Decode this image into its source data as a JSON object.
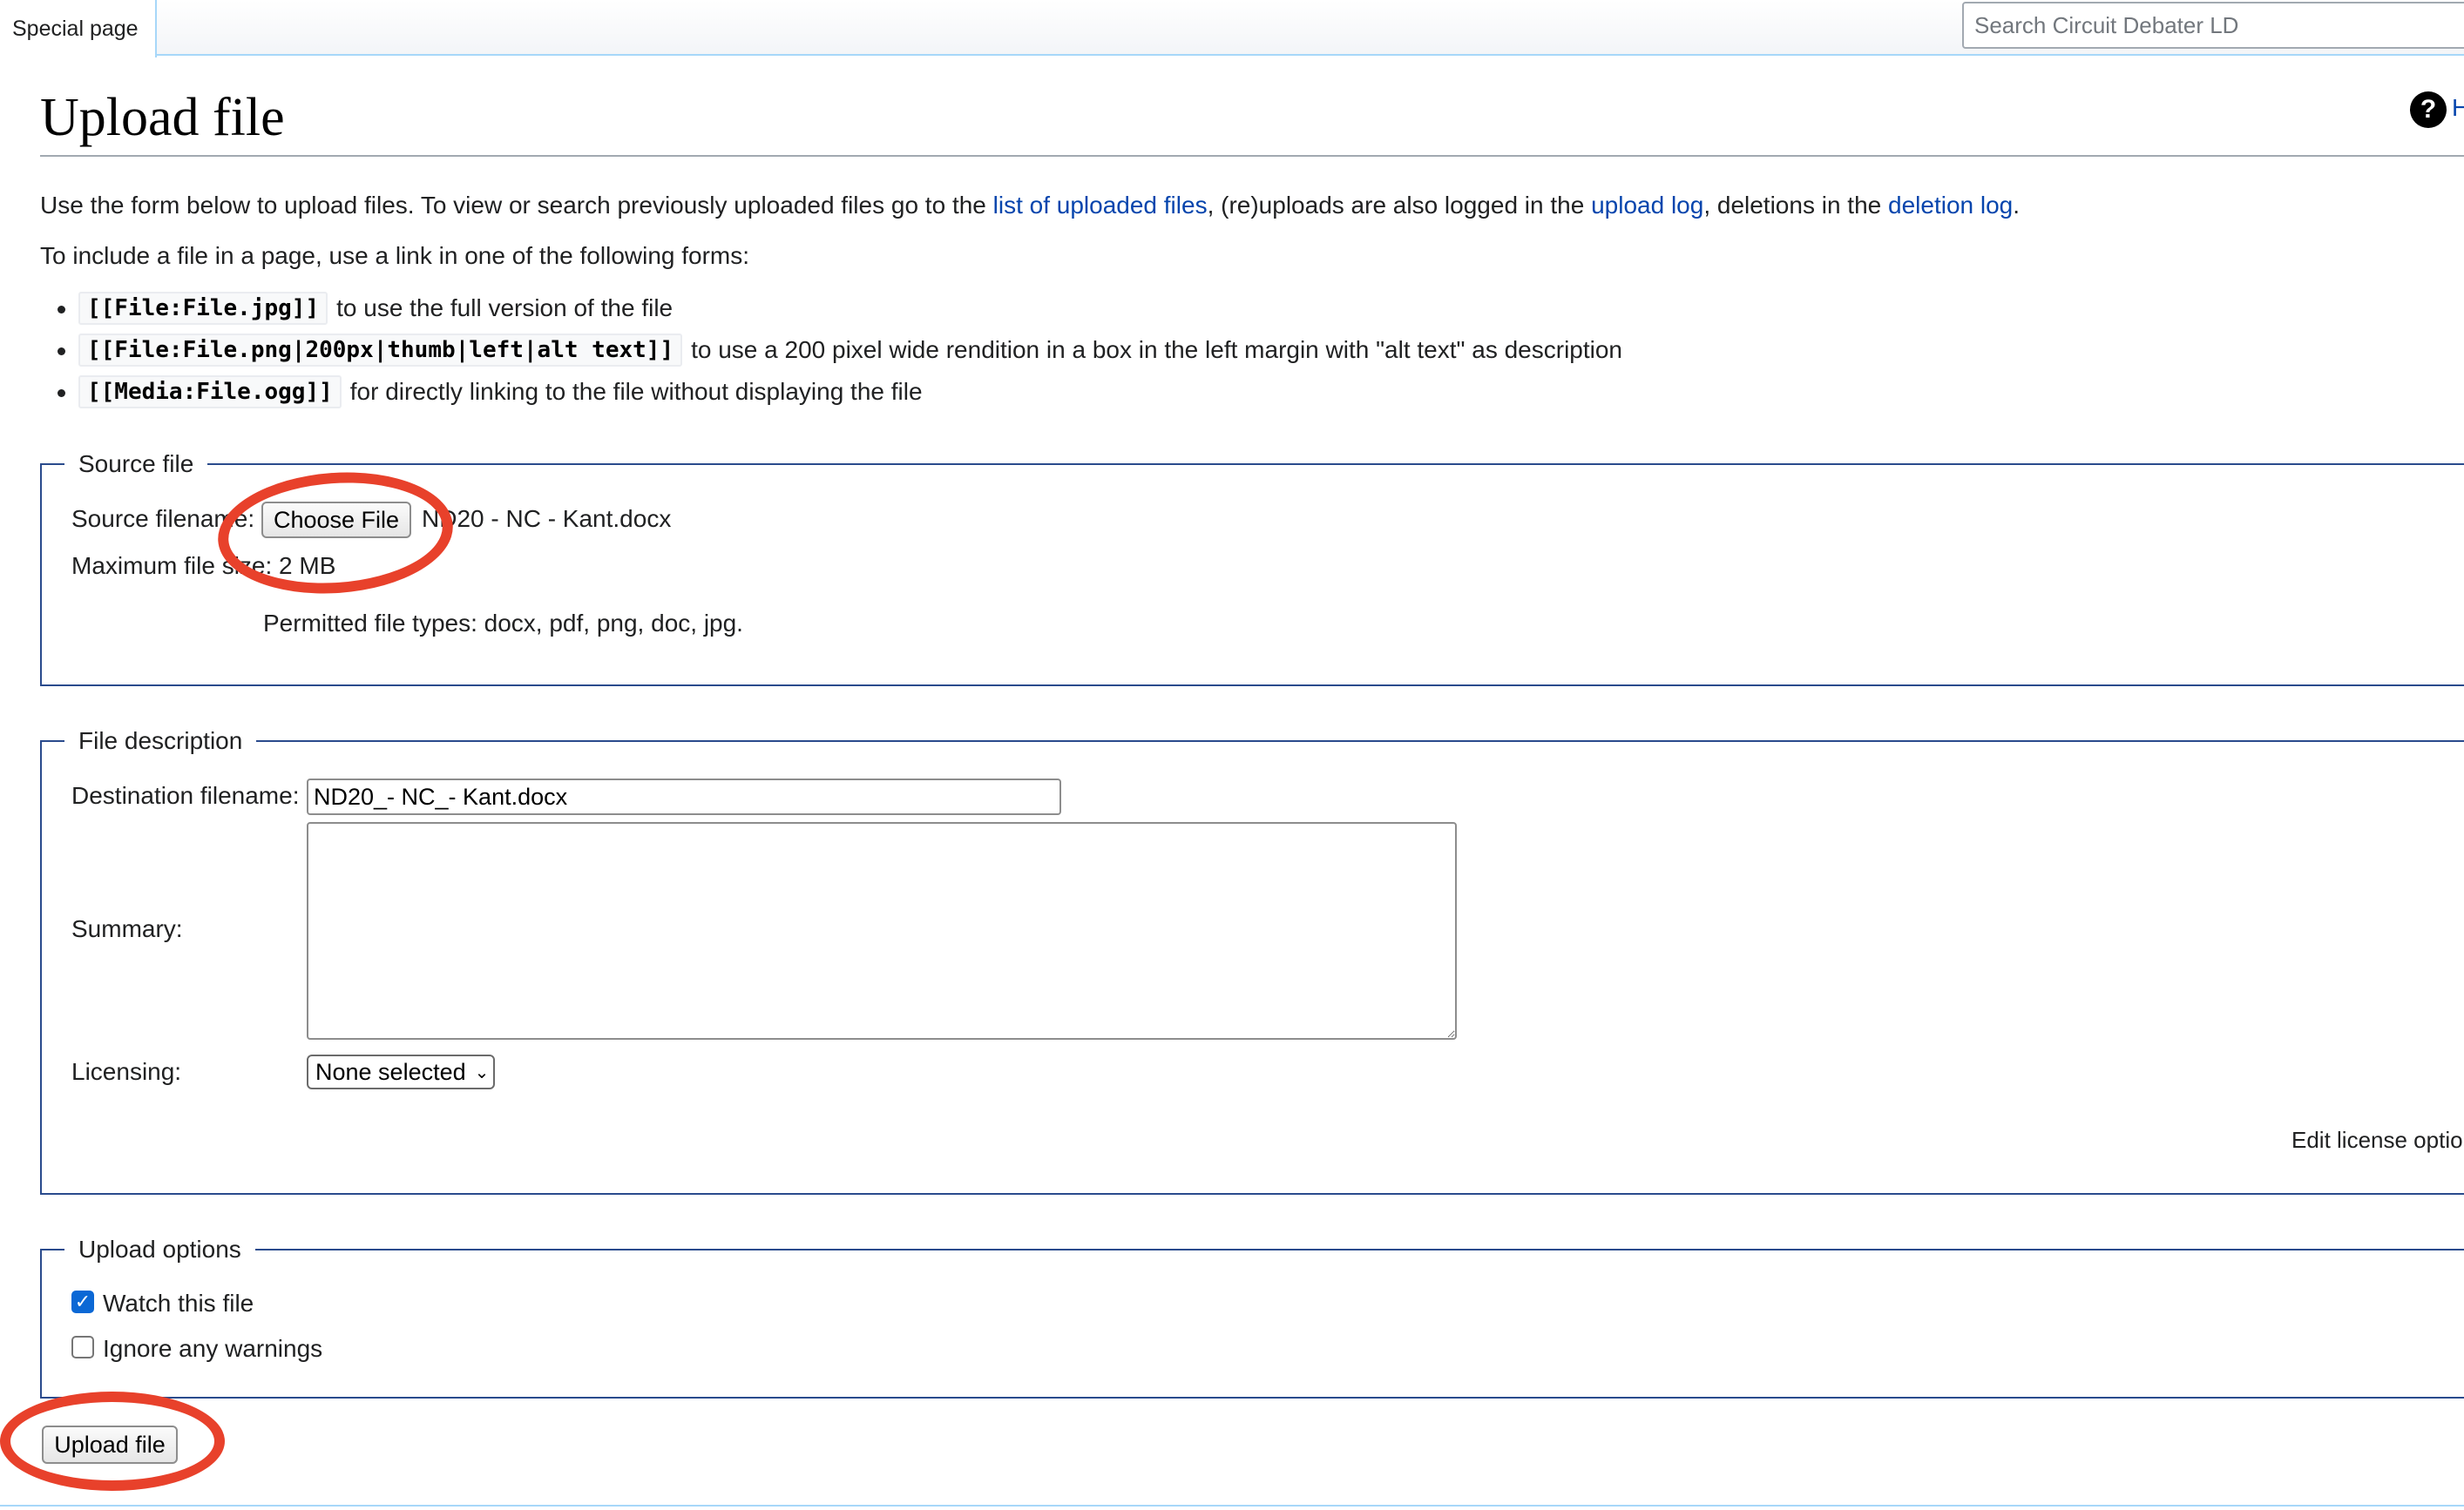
{
  "header": {
    "namespace_tab": "Special page",
    "search_placeholder": "Search Circuit Debater LD"
  },
  "page": {
    "title": "Upload file",
    "help_label": "H"
  },
  "intro": {
    "line1_before": "Use the form below to upload files. To view or search previously uploaded files go to the ",
    "link_uploaded_files": "list of uploaded files",
    "line1_mid": ", (re)uploads are also logged in the ",
    "link_upload_log": "upload log",
    "line1_mid2": ", deletions in the ",
    "link_deletion_log": "deletion log",
    "line1_end": ".",
    "line2": "To include a file in a page, use a link in one of the following forms:",
    "forms": [
      {
        "code": "[[File:File.jpg]]",
        "text": "to use the full version of the file"
      },
      {
        "code": "[[File:File.png|200px|thumb|left|alt text]]",
        "text": "to use a 200 pixel wide rendition in a box in the left margin with \"alt text\" as description"
      },
      {
        "code": "[[Media:File.ogg]]",
        "text": "for directly linking to the file without displaying the file"
      }
    ]
  },
  "source_file": {
    "legend": "Source file",
    "filename_label": "Source filename:",
    "choose_button": "Choose File",
    "chosen_file": "ND20 - NC - Kant.docx",
    "max_size": "Maximum file size: 2 MB",
    "permitted_types": "Permitted file types: docx, pdf, png, doc, jpg."
  },
  "file_description": {
    "legend": "File description",
    "destination_label": "Destination filename:",
    "destination_value": "ND20_- NC_- Kant.docx",
    "summary_label": "Summary:",
    "summary_value": "",
    "licensing_label": "Licensing:",
    "licensing_selected": "None selected",
    "edit_license_link": "Edit license options"
  },
  "upload_options": {
    "legend": "Upload options",
    "watch_label": "Watch this file",
    "watch_checked": true,
    "ignore_label": "Ignore any warnings",
    "ignore_checked": false
  },
  "actions": {
    "upload_button": "Upload file"
  },
  "colors": {
    "link": "#0645ad",
    "fieldset_border": "#2a4b8d",
    "annotation": "#e8412b",
    "checkbox_accent": "#0b68d5"
  }
}
